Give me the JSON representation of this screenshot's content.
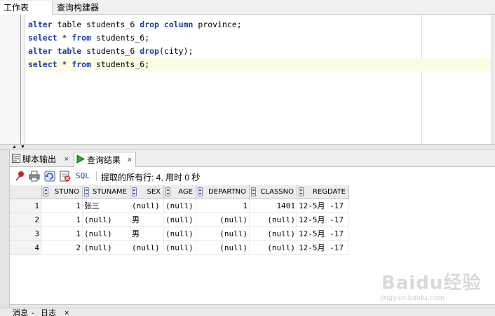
{
  "top_tabs": {
    "worksheet": "工作表",
    "query_builder": "查询构建器"
  },
  "editor": {
    "lines": [
      [
        [
          "alter",
          "kw"
        ],
        [
          " table ",
          "t"
        ],
        [
          "students_6",
          "t"
        ],
        [
          " ",
          "t"
        ],
        [
          "drop",
          "kw"
        ],
        [
          " ",
          "t"
        ],
        [
          "column",
          "kw"
        ],
        [
          " province;",
          "t"
        ]
      ],
      [
        [
          "select",
          "kw"
        ],
        [
          " * ",
          "t"
        ],
        [
          "from",
          "kw"
        ],
        [
          " students_6;",
          "t"
        ]
      ],
      [
        [
          "alter",
          "kw"
        ],
        [
          " ",
          "t"
        ],
        [
          "table",
          "kw"
        ],
        [
          " students_6 ",
          "t"
        ],
        [
          "drop",
          "kw"
        ],
        [
          "(city);",
          "t"
        ]
      ],
      [
        [
          "select",
          "kw"
        ],
        [
          " * ",
          "t"
        ],
        [
          "from",
          "kw"
        ],
        [
          " students_6;",
          "t"
        ]
      ]
    ],
    "current_line": 3
  },
  "panel_tabs": {
    "script_output": "脚本输出",
    "query_result": "查询结果",
    "close": "×"
  },
  "toolbar": {
    "sql": "SQL",
    "status": "提取的所有行: 4, 用时 0 秒"
  },
  "grid": {
    "columns": [
      "STUNO",
      "STUNAME",
      "SEX",
      "AGE",
      "DEPARTNO",
      "CLASSNO",
      "REGDATE"
    ],
    "rows": [
      {
        "n": "1",
        "cells": [
          "1",
          "张三",
          "(null)",
          "(null)",
          "1",
          "1401",
          "12-5月 -17"
        ]
      },
      {
        "n": "2",
        "cells": [
          "1",
          "(null)",
          "男",
          "(null)",
          "(null)",
          "(null)",
          "12-5月 -17"
        ]
      },
      {
        "n": "3",
        "cells": [
          "1",
          "(null)",
          "男",
          "(null)",
          "(null)",
          "(null)",
          "12-5月 -17"
        ]
      },
      {
        "n": "4",
        "cells": [
          "2",
          "(null)",
          "(null)",
          "(null)",
          "(null)",
          "(null)",
          "12-5月 -17"
        ]
      }
    ]
  },
  "bottom_tabs": {
    "messages": "消息",
    "log": "日志"
  },
  "watermark": {
    "logo": "Baidu经验",
    "url": "jingyan.baidu.com"
  },
  "colors": {
    "keyword": "#1a3ea8",
    "current_line": "#fcfce4",
    "header_bg": "#ececec"
  }
}
